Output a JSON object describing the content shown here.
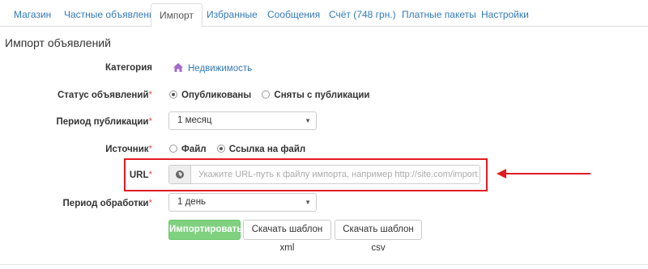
{
  "tabs": [
    {
      "label": "Магазин",
      "active": false
    },
    {
      "label": "Частные объявления",
      "active": false
    },
    {
      "label": "Импорт",
      "active": true
    },
    {
      "label": "Избранные",
      "active": false
    },
    {
      "label": "Сообщения",
      "active": false
    },
    {
      "label": "Счёт (748 грн.)",
      "active": false
    },
    {
      "label": "Платные пакеты",
      "active": false
    },
    {
      "label": "Настройки",
      "active": false
    }
  ],
  "page": {
    "title": "Импорт объявлений"
  },
  "form": {
    "required_mark": "*",
    "category": {
      "label": "Категория",
      "value": "Недвижимость",
      "icon": "home-icon",
      "icon_color": "#a56bc9"
    },
    "status": {
      "label": "Статус объявлений",
      "options": [
        {
          "label": "Опубликованы",
          "checked": true
        },
        {
          "label": "Сняты с публикации",
          "checked": false
        }
      ]
    },
    "period": {
      "label": "Период публикации",
      "value": "1 месяц"
    },
    "source": {
      "label": "Источник",
      "options": [
        {
          "label": "Файл",
          "checked": false
        },
        {
          "label": "Ссылка на файл",
          "checked": true
        }
      ]
    },
    "url": {
      "label": "URL",
      "icon": "globe-icon",
      "value": "",
      "placeholder": "Укажите URL-путь к файлу импорта, например http://site.com/import.xml"
    },
    "processing": {
      "label": "Период обработки",
      "value": "1 день"
    }
  },
  "buttons": {
    "import": "Импортировать",
    "xml_template": "Скачать шаблон xml",
    "csv_template": "Скачать шаблон csv"
  },
  "colors": {
    "annotation": "#e11b22",
    "primary_button": "#7fd17f",
    "link": "#337ab7"
  }
}
